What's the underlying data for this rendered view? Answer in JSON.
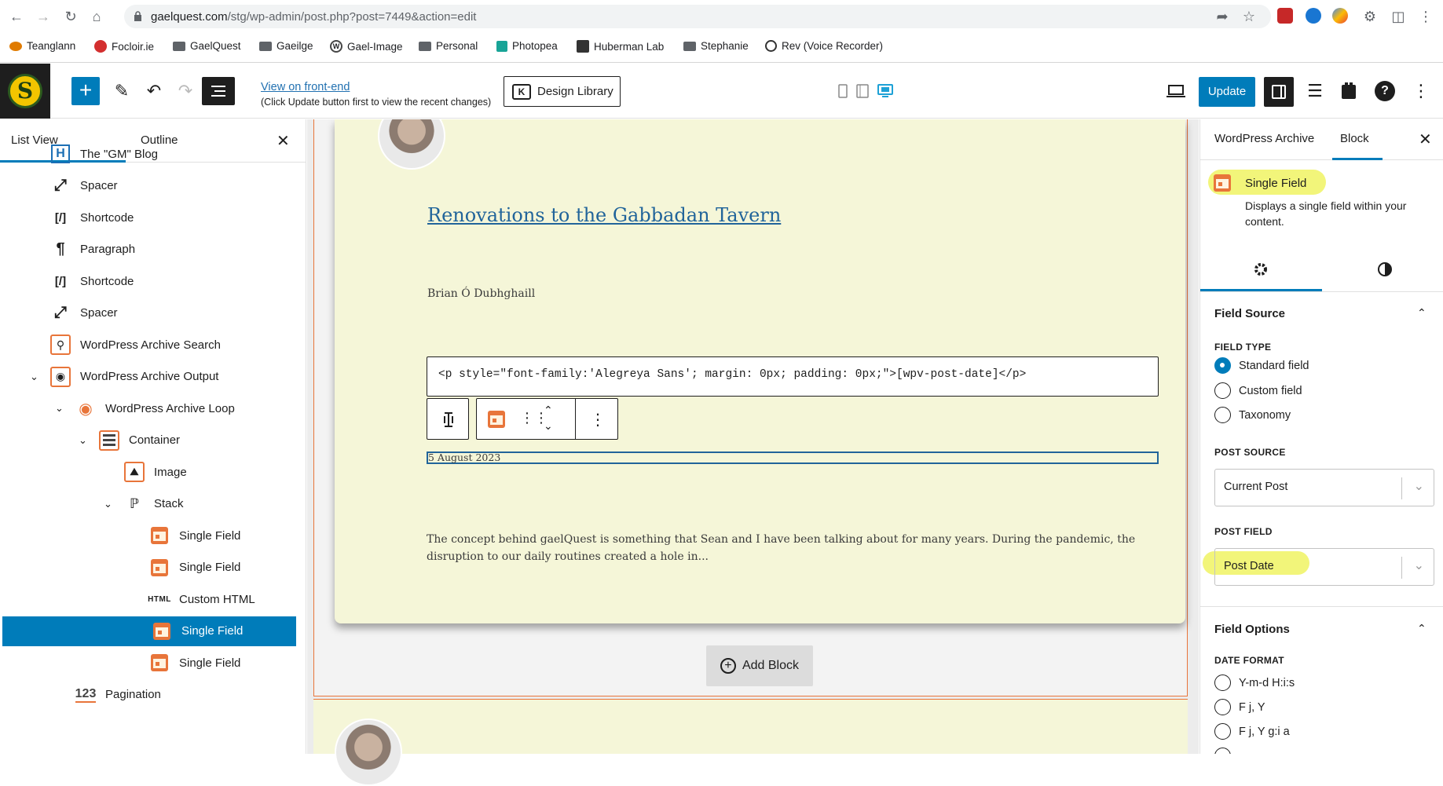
{
  "browser": {
    "url_domain": "gaelquest.com",
    "url_path": "/stg/wp-admin/post.php?post=7449&action=edit",
    "bookmarks": [
      {
        "label": "Teanglann",
        "icon": "teanglann-icon"
      },
      {
        "label": "Focloir.ie",
        "icon": "focloir-icon"
      },
      {
        "label": "GaelQuest",
        "icon": "folder-icon"
      },
      {
        "label": "Gaeilge",
        "icon": "folder-icon"
      },
      {
        "label": "Gael-Image",
        "icon": "wordpress-icon"
      },
      {
        "label": "Personal",
        "icon": "folder-icon"
      },
      {
        "label": "Photopea",
        "icon": "photopea-icon"
      },
      {
        "label": "Huberman Lab",
        "icon": "huberman-icon"
      },
      {
        "label": "Stephanie",
        "icon": "folder-icon"
      },
      {
        "label": "Rev (Voice Recorder)",
        "icon": "rev-icon"
      }
    ]
  },
  "toolbar": {
    "view_front_label": "View on front-end",
    "view_front_note": "(Click Update button first to view the recent changes)",
    "design_library_label": "Design Library",
    "update_label": "Update",
    "accent": "#007cba"
  },
  "list_view": {
    "tab_list": "List View",
    "tab_outline": "Outline",
    "items": [
      {
        "label": "The \"GM\" Blog",
        "icon": "heading-icon",
        "level": 0,
        "expanded": null,
        "selected": false
      },
      {
        "label": "Spacer",
        "icon": "spacer-icon",
        "level": 0,
        "expanded": null,
        "selected": false
      },
      {
        "label": "Shortcode",
        "icon": "shortcode-icon",
        "level": 0,
        "expanded": null,
        "selected": false
      },
      {
        "label": "Paragraph",
        "icon": "paragraph-icon",
        "level": 0,
        "expanded": null,
        "selected": false
      },
      {
        "label": "Shortcode",
        "icon": "shortcode-icon",
        "level": 0,
        "expanded": null,
        "selected": false
      },
      {
        "label": "Spacer",
        "icon": "spacer-icon",
        "level": 0,
        "expanded": null,
        "selected": false
      },
      {
        "label": "WordPress Archive Search",
        "icon": "search-icon",
        "level": 0,
        "expanded": null,
        "selected": false
      },
      {
        "label": "WordPress Archive Output",
        "icon": "eye-icon",
        "level": 0,
        "expanded": true,
        "selected": false
      },
      {
        "label": "WordPress Archive Loop",
        "icon": "loop-icon",
        "level": 1,
        "expanded": true,
        "selected": false
      },
      {
        "label": "Container",
        "icon": "container-icon",
        "level": 2,
        "expanded": true,
        "selected": false
      },
      {
        "label": "Image",
        "icon": "image-icon",
        "level": 3,
        "expanded": null,
        "selected": false
      },
      {
        "label": "Stack",
        "icon": "stack-icon",
        "level": 3,
        "expanded": true,
        "selected": false
      },
      {
        "label": "Single Field",
        "icon": "calendar-icon",
        "level": 4,
        "expanded": null,
        "selected": false
      },
      {
        "label": "Single Field",
        "icon": "calendar-icon",
        "level": 4,
        "expanded": null,
        "selected": false
      },
      {
        "label": "Custom HTML",
        "icon": "html-icon",
        "level": 4,
        "expanded": null,
        "selected": false
      },
      {
        "label": "Single Field",
        "icon": "calendar-icon",
        "level": 4,
        "expanded": null,
        "selected": true
      },
      {
        "label": "Single Field",
        "icon": "calendar-icon",
        "level": 4,
        "expanded": null,
        "selected": false
      },
      {
        "label": "Pagination",
        "icon": "pagination-icon",
        "level": 1,
        "expanded": null,
        "selected": false
      }
    ]
  },
  "canvas": {
    "post_title": "Renovations to the Gabbadan Tavern",
    "author": "Brian Ó Dubhghaill",
    "html_code": "<p style=\"font-family:'Alegreya Sans'; margin: 0px; padding: 0px;\">[wpv-post-date]</p>",
    "date_value": "5 August 2023",
    "excerpt": "The concept behind gaelQuest is something that Sean and I have been talking about for many years. During the pandemic, the disruption to our daily routines created a hole in...",
    "add_block_label": "Add Block"
  },
  "settings": {
    "tab_archive": "WordPress Archive",
    "tab_block": "Block",
    "block_name": "Single Field",
    "block_description": "Displays a single field within your content.",
    "field_source_title": "Field Source",
    "field_type_label": "FIELD TYPE",
    "field_type_options": [
      {
        "label": "Standard field",
        "checked": true
      },
      {
        "label": "Custom field",
        "checked": false
      },
      {
        "label": "Taxonomy",
        "checked": false
      }
    ],
    "post_source_label": "POST SOURCE",
    "post_source_value": "Current Post",
    "post_field_label": "POST FIELD",
    "post_field_value": "Post Date",
    "field_options_title": "Field Options",
    "date_format_label": "DATE FORMAT",
    "date_format_options": [
      {
        "label": "Y-m-d H:i:s",
        "checked": false
      },
      {
        "label": "F j, Y",
        "checked": false
      },
      {
        "label": "F j, Y g:i a",
        "checked": false
      }
    ],
    "highlight_color": "#f2f57a"
  }
}
